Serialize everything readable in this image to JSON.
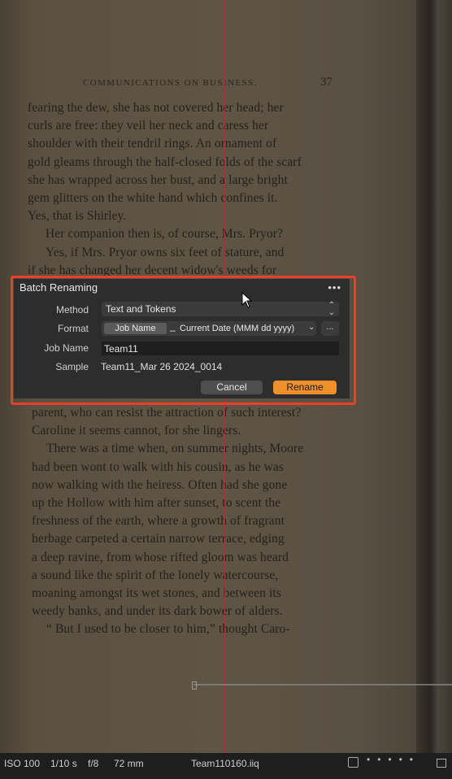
{
  "book": {
    "running_head": "COMMUNICATIONS ON BUSINESS.",
    "page_number": "37",
    "lines_top": [
      "fearing the dew, she has not covered her head; her",
      "curls are free: they veil her neck and caress her",
      "shoulder with their tendril rings. An ornament of",
      "gold gleams through the half-closed folds of the scarf",
      "she has wrapped across her bust, and a large bright",
      "gem glitters on the white hand which confines it.",
      "Yes, that is Shirley.",
      "Her companion then is, of course, Mrs. Pryor?",
      "Yes, if Mrs. Pryor owns six feet of stature, and",
      "if she has changed her decent widow's weeds for"
    ],
    "lines_bottom": [
      "parent, who can resist the attraction of such interest?",
      "Caroline it seems cannot, for she lingers.",
      "There was a time when, on summer nights, Moore",
      "had been wont to walk with his cousin, as he was",
      "now walking with the heiress. Often had she gone",
      "up the Hollow with him after sunset, to scent the",
      "freshness of the earth, where a growth of fragrant",
      "herbage carpeted a certain narrow terrace, edging",
      "a deep ravine, from whose rifted gloom was heard",
      "a sound like the spirit of the lonely watercourse,",
      "moaning amongst its wet stones, and between its",
      "weedy banks, and under its dark bower of alders.",
      "“ But I used to be closer to him,” thought Caro-"
    ]
  },
  "dialog": {
    "title": "Batch Renaming",
    "more_icon": "•••",
    "method_label": "Method",
    "method_value": "Text and Tokens",
    "format_label": "Format",
    "token_1": "Job Name",
    "token_separator": "_",
    "token_2": "Current Date (MMM dd yyyy)",
    "format_more": "...",
    "job_name_label": "Job Name",
    "job_name_value": "Team11",
    "sample_label": "Sample",
    "sample_value": "Team11_Mar 26 2024_0014",
    "cancel_label": "Cancel",
    "rename_label": "Rename",
    "rename_color": "#f0902c",
    "highlight_color": "#e8402a"
  },
  "statusbar": {
    "iso": "ISO 100",
    "shutter": "1/10 s",
    "aperture": "f/8",
    "focal_length": "72 mm",
    "filename": "Team110160.iiq"
  }
}
